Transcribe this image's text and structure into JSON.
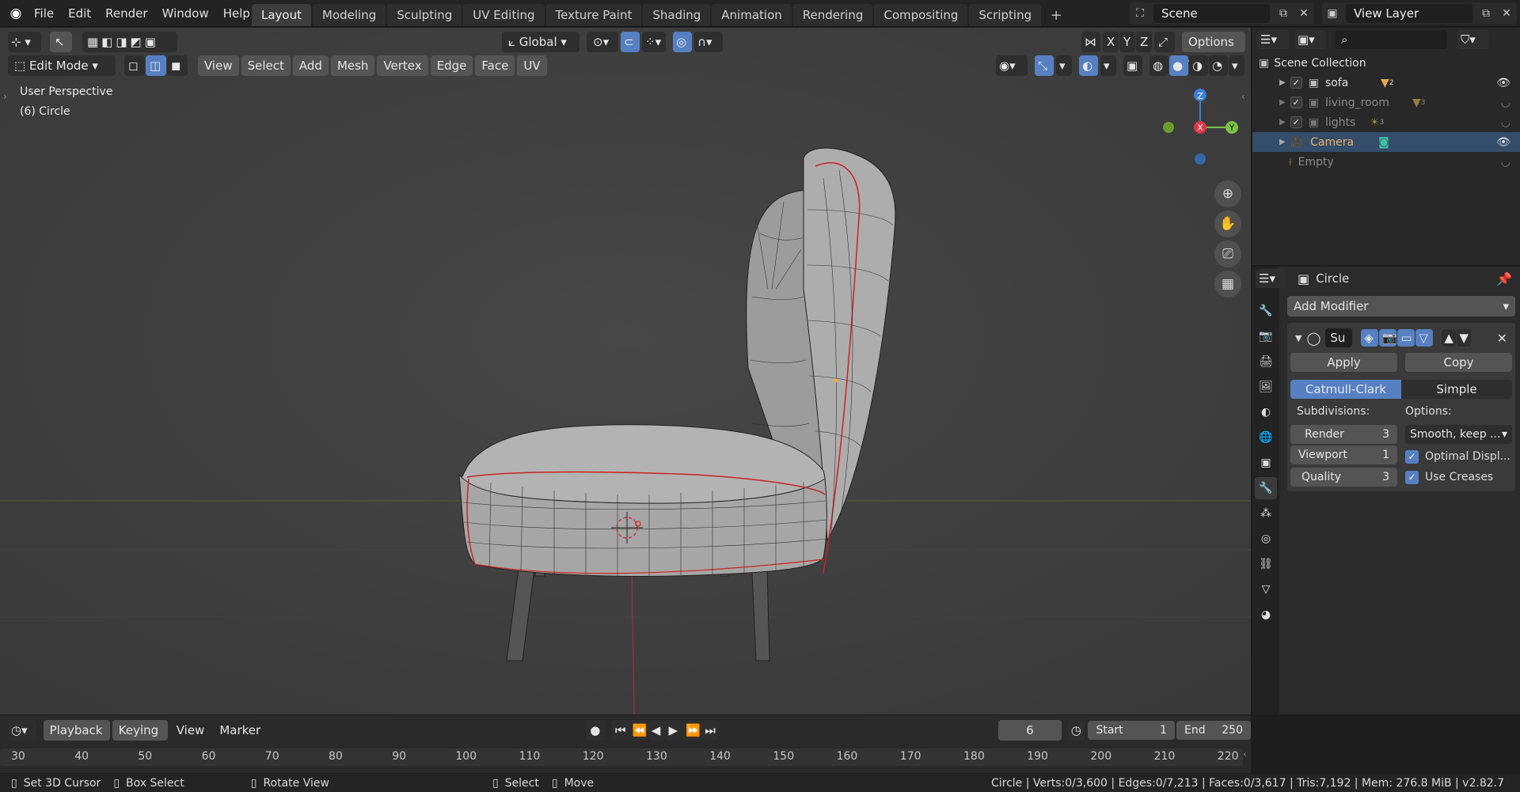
{
  "menu": {
    "items": [
      "File",
      "Edit",
      "Render",
      "Window",
      "Help"
    ]
  },
  "workspaces": {
    "tabs": [
      "Layout",
      "Modeling",
      "Sculpting",
      "UV Editing",
      "Texture Paint",
      "Shading",
      "Animation",
      "Rendering",
      "Compositing",
      "Scripting"
    ],
    "active": "Layout",
    "add_label": "+"
  },
  "scene": {
    "name": "Scene"
  },
  "view_layer": {
    "name": "View Layer"
  },
  "viewport": {
    "transform_orientation": "Global",
    "options_label": "Options",
    "axes": [
      "X",
      "Y",
      "Z"
    ],
    "mode": "Edit Mode",
    "header_menus": [
      "View",
      "Select",
      "Add",
      "Mesh",
      "Vertex",
      "Edge",
      "Face",
      "UV"
    ],
    "overlay_text": {
      "perspective": "User Perspective",
      "object": "(6) Circle"
    },
    "gizmo": {
      "x": "X",
      "y": "Y",
      "z": "Z"
    }
  },
  "outliner": {
    "root": "Scene Collection",
    "items": [
      {
        "name": "sofa",
        "badge": "2",
        "visible": true
      },
      {
        "name": "living_room",
        "badge": "3",
        "visible": false
      },
      {
        "name": "lights",
        "badge": "3",
        "visible": false
      },
      {
        "name": "Camera",
        "badge": "",
        "visible": true
      },
      {
        "name": "Empty",
        "badge": "",
        "visible": false
      }
    ]
  },
  "properties": {
    "object_name": "Circle",
    "add_modifier": "Add Modifier",
    "modifier_short": "Su",
    "apply": "Apply",
    "copy": "Copy",
    "catmull": "Catmull-Clark",
    "simple": "Simple",
    "subdivisions_label": "Subdivisions:",
    "options_label": "Options:",
    "render_label": "Render",
    "render_value": "3",
    "viewport_label": "Viewport",
    "viewport_value": "1",
    "quality_label": "Quality",
    "quality_value": "3",
    "uv_smooth": "Smooth, keep ...",
    "optimal_display": "Optimal Displ...",
    "use_creases": "Use Creases"
  },
  "timeline": {
    "menus": [
      "Playback",
      "Keying",
      "View",
      "Marker"
    ],
    "current_frame": "6",
    "start_label": "Start",
    "start_value": "1",
    "end_label": "End",
    "end_value": "250",
    "ruler": [
      "30",
      "40",
      "50",
      "60",
      "70",
      "80",
      "90",
      "100",
      "110",
      "120",
      "130",
      "140",
      "150",
      "160",
      "170",
      "180",
      "190",
      "200",
      "210",
      "220"
    ]
  },
  "status": {
    "set_cursor": "Set 3D Cursor",
    "box_select": "Box Select",
    "rotate_view": "Rotate View",
    "select": "Select",
    "move": "Move",
    "stats": "Circle | Verts:0/3,600 | Edges:0/7,213 | Faces:0/3,617 | Tris:7,192 | Mem: 276.8 MiB | v2.82.7"
  },
  "colors": {
    "accent": "#5680c2",
    "active_row": "#334d6a",
    "viewport_bg": "#3d3d3d"
  }
}
